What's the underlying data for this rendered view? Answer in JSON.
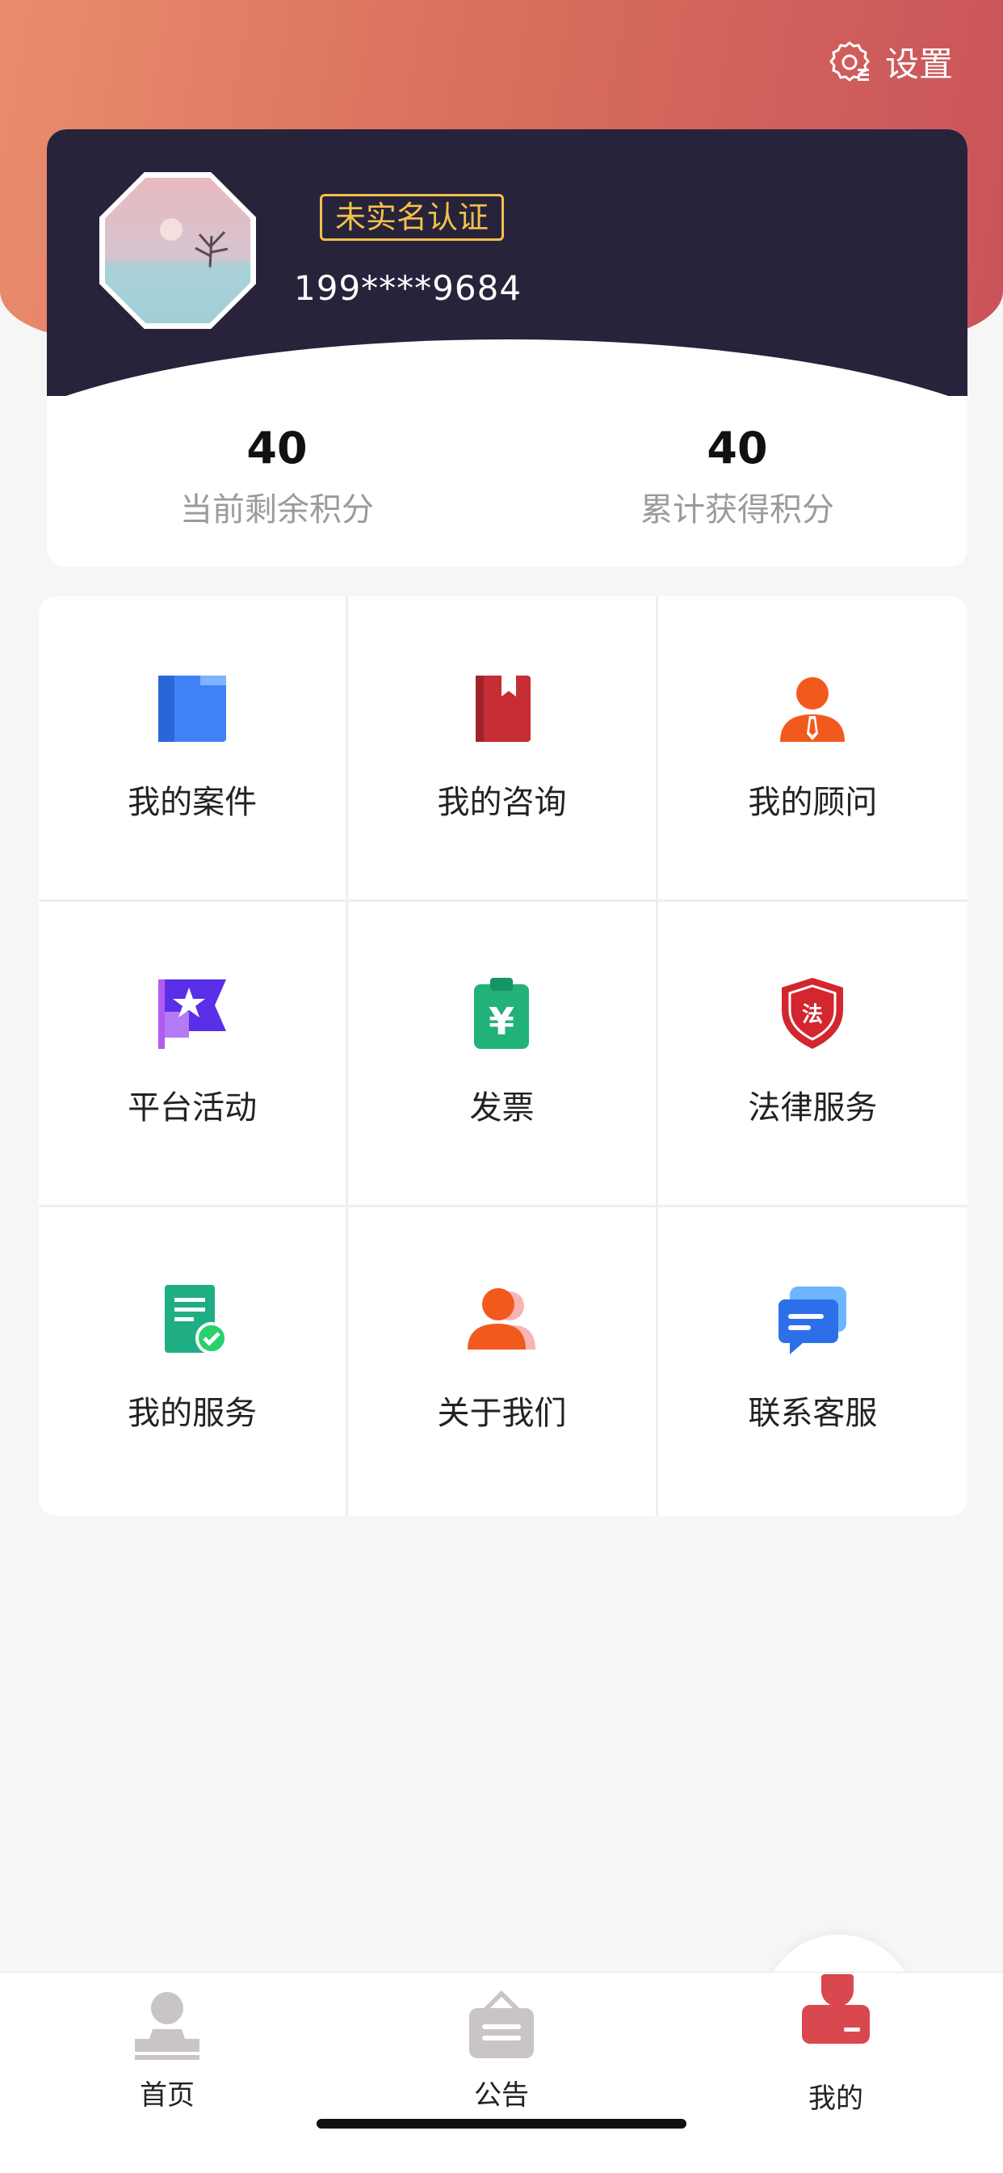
{
  "header": {
    "settings_label": "设置"
  },
  "profile": {
    "badge": "未实名认证",
    "phone": "199****9684",
    "points": [
      {
        "value": "40",
        "label": "当前剩余积分"
      },
      {
        "value": "40",
        "label": "累计获得积分"
      }
    ]
  },
  "menu": [
    {
      "label": "我的案件",
      "icon": "folder-icon"
    },
    {
      "label": "我的咨询",
      "icon": "notebook-icon"
    },
    {
      "label": "我的顾问",
      "icon": "advisor-icon"
    },
    {
      "label": "平台活动",
      "icon": "flag-star-icon"
    },
    {
      "label": "发票",
      "icon": "invoice-icon"
    },
    {
      "label": "法律服务",
      "icon": "law-shield-icon"
    },
    {
      "label": "我的服务",
      "icon": "service-doc-icon"
    },
    {
      "label": "关于我们",
      "icon": "people-icon"
    },
    {
      "label": "联系客服",
      "icon": "chat-icon"
    }
  ],
  "icon_glyph_law": "法",
  "icon_glyph_yen": "¥",
  "tabbar": [
    {
      "label": "首页",
      "icon": "home-stamp-icon"
    },
    {
      "label": "公告",
      "icon": "notice-icon"
    },
    {
      "label": "我的",
      "icon": "profile-icon",
      "active": true
    }
  ],
  "colors": {
    "accent": "#d9474f",
    "card_dark": "#27233b",
    "badge": "#f2c14b"
  }
}
